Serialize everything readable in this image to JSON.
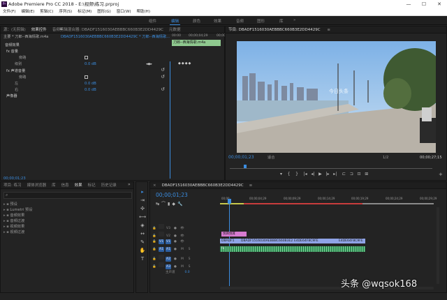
{
  "app": {
    "title": "Adobe Premiere Pro CC 2018 - E:\\视频\\练习.prproj",
    "logo": "Pr",
    "window_controls": {
      "minimize": "—",
      "maximize": "☐",
      "close": "✕"
    }
  },
  "menu": [
    "文件(F)",
    "编辑(E)",
    "剪辑(C)",
    "序列(S)",
    "标记(M)",
    "图形(G)",
    "窗口(W)",
    "帮助(H)"
  ],
  "workspaces": {
    "items": [
      "组件",
      "编辑",
      "颜色",
      "效果",
      "音频",
      "图形",
      "库"
    ],
    "active": "编辑",
    "more": "»"
  },
  "effect_controls": {
    "tabs": [
      "源：(无剪辑)",
      "效果控件",
      "音频剪辑混合器: DBADF1516030AEBBBC660B3E2DD4429C",
      "元数据"
    ],
    "tab_menu": "≡",
    "master_path": "主要 * 刀郎--西海情歌.m4a",
    "sequence_path": "DBADF1516030AEBBBC660B3E2DD4429C * 刀郎--西海情歌...",
    "mini_timecode_start": "00:00",
    "mini_timecode_mid": "00;00;04;29",
    "mini_timecode_end": "00;00",
    "clip_label": "刀郎--西海情歌.m4a",
    "sections": {
      "audio_effects": "音频效果",
      "volume": "fx 音量",
      "bypass": "旁路",
      "level": "级别",
      "level_value": "0.0 dB",
      "channel_volume": "fx 声道音量",
      "bypass2": "旁路",
      "left": "左",
      "left_value": "0.0 dB",
      "right": "右",
      "right_value": "0.0 dB",
      "panner": "声像器"
    },
    "timecode": "00;00;01;23"
  },
  "program_monitor": {
    "title": "节目: DBADF1516030AEBBBC660B3E2DD4429C",
    "tab_menu": "≡",
    "watermark": "今日头条",
    "timecode": "00;00;01;23",
    "fit_label": "适合",
    "scale": "1/2",
    "duration": "00;00;27;15",
    "transport": [
      "▾",
      "{",
      "}",
      "|◂",
      "◂|",
      "▶",
      "|▸",
      "▸|",
      "⊏",
      "⊐",
      "⊡",
      "⊞",
      "+"
    ]
  },
  "project_panel": {
    "tabs": [
      "项目: 练习",
      "媒体浏览器",
      "库",
      "信息",
      "效果",
      "标记",
      "历史记录"
    ],
    "more": "»",
    "active": "效果",
    "search_icon": "search-icon",
    "items": [
      "预设",
      "Lumetri 预设",
      "音频效果",
      "音频过渡",
      "视频效果",
      "视频过渡"
    ]
  },
  "tools": [
    "▸",
    "⇥",
    "✣",
    "⟷",
    "◈",
    "↔",
    "✎",
    "✋",
    "T"
  ],
  "timeline": {
    "tab_title": "DBADF1516030AEBBBC660B3E2DD4429C",
    "tab_menu": "≡",
    "close_glyph": "×",
    "timecode": "00;00;01;23",
    "ruler": [
      "00;00",
      "00;00;04;29",
      "00;00;09;29",
      "00;00;14;29",
      "00;00;19;29",
      "00;00;24;29",
      "00;00;29;29"
    ],
    "tracks": [
      {
        "lock": "🔒",
        "src": "",
        "name": "V3",
        "toggle": "●",
        "eye": "👁",
        "m": "",
        "s": ""
      },
      {
        "lock": "🔒",
        "src": "",
        "name": "V2",
        "toggle": "●",
        "eye": "👁",
        "m": "",
        "s": ""
      },
      {
        "lock": "🔒",
        "src": "V1",
        "name": "V1",
        "toggle": "●",
        "eye": "👁",
        "m": "",
        "s": ""
      },
      {
        "lock": "🔒",
        "src": "A1",
        "name": "A1",
        "toggle": "●",
        "eye": "",
        "m": "M",
        "s": "S"
      },
      {
        "lock": "🔒",
        "src": "",
        "name": "A2",
        "toggle": "●",
        "eye": "",
        "m": "M",
        "s": "S"
      },
      {
        "lock": "🔒",
        "src": "",
        "name": "A3",
        "toggle": "●",
        "eye": "",
        "m": "M",
        "s": "S"
      }
    ],
    "master_label": "主声道",
    "master_value": "0.0",
    "clips": {
      "title": "悦目悦耳",
      "video1": "DBADF1",
      "video2": "DBADF1516030AEBBBC660B3E2DD442",
      "video3": "E4DE64F8C9FE",
      "video4": "E4DE64F8C9FE",
      "audio": "fx"
    }
  },
  "watermark_text": "头条 @wqsok168",
  "colors": {
    "accent": "#3b8de0",
    "playhead": "#3b8de0",
    "title_clip": "#d77bd0",
    "video_clip": "#8fa3e6",
    "audio_clip": "#2f8a52"
  }
}
